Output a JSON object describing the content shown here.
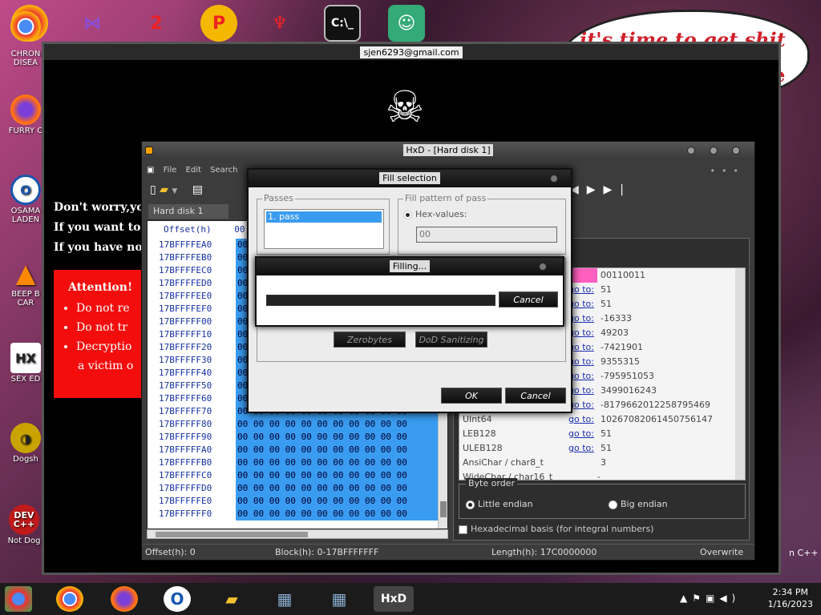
{
  "desktop": {
    "left_icons": [
      {
        "label": "CHRON\nDISEA",
        "icon": "chrome-icon"
      },
      {
        "label": "FURRY C",
        "icon": "firefox-icon"
      },
      {
        "label": "OSAMA\nLADEN",
        "icon": "obama-icon"
      },
      {
        "label": "BEEP B\nCAR",
        "icon": "vlc-icon"
      },
      {
        "label": "SEX ED",
        "icon": "hxd-icon"
      },
      {
        "label": "Dogsh",
        "icon": "dog-icon"
      },
      {
        "label": "Not Dog",
        "icon": "devcpp-icon"
      }
    ],
    "bubble_text": "it's time to get shit",
    "bubble_text2": "te",
    "right_label": "n C++"
  },
  "ransom": {
    "title": "sjen6293@gmail.com",
    "line1": "Don't worry,yo",
    "line2": "If you want to",
    "line3": "If you have not",
    "attention_title": "Attention!",
    "bullets": [
      "Do not re",
      "Do not tr",
      "Decryptio"
    ],
    "bullet_tail": "a victim o"
  },
  "hxd": {
    "title": "HxD - [Hard disk 1]",
    "menu": [
      "File",
      "Edit",
      "Search"
    ],
    "tab": "Hard disk 1",
    "hex_header": "Offset(h)",
    "hex_col": "00",
    "rows": [
      {
        "off": "17BFFFFEA0",
        "data": "00 00 00 00 00 00 00 00 00 00 00"
      },
      {
        "off": "17BFFFFEB0",
        "data": "00 00 00 00 00 00 00 00 00 00 00"
      },
      {
        "off": "17BFFFFEC0",
        "data": "00 00 00 00 00 00 00 00 00 00 00"
      },
      {
        "off": "17BFFFFED0",
        "data": "00 00 00 00 00 00 00 00 00 00 00"
      },
      {
        "off": "17BFFFFEE0",
        "data": "00 00 00 00 00 00 00 00 00 00 00"
      },
      {
        "off": "17BFFFFEF0",
        "data": "00 00 00 00 00 00 00 00 00 00 00"
      },
      {
        "off": "17BFFFFF00",
        "data": "00 00 00 00 00 00 00 00 00 00 00"
      },
      {
        "off": "17BFFFFF10",
        "data": "00 00 00 00 00 00 00 00 00 00 00"
      },
      {
        "off": "17BFFFFF20",
        "data": "00 00 00 00 00 00 00 00 00 00 00"
      },
      {
        "off": "17BFFFFF30",
        "data": "00 00 00 00 00 00 00 00 00 00 00"
      },
      {
        "off": "17BFFFFF40",
        "data": "00 00 00 00 00 00 00 00 00 00 00"
      },
      {
        "off": "17BFFFFF50",
        "data": "00 00 00 00 00 00 00 00 00 00 00"
      },
      {
        "off": "17BFFFFF60",
        "data": "00 00 00 00 00 00 00 00 00 00 00"
      },
      {
        "off": "17BFFFFF70",
        "data": "00 00 00 00 00 00 00 00 00 00 00"
      },
      {
        "off": "17BFFFFF80",
        "data": "00 00 00 00 00 00 00 00 00 00 00"
      },
      {
        "off": "17BFFFFF90",
        "data": "00 00 00 00 00 00 00 00 00 00 00"
      },
      {
        "off": "17BFFFFFA0",
        "data": "00 00 00 00 00 00 00 00 00 00 00"
      },
      {
        "off": "17BFFFFFB0",
        "data": "00 00 00 00 00 00 00 00 00 00 00"
      },
      {
        "off": "17BFFFFFC0",
        "data": "00 00 00 00 00 00 00 00 00 00 00"
      },
      {
        "off": "17BFFFFFD0",
        "data": "00 00 00 00 00 00 00 00 00 00 00"
      },
      {
        "off": "17BFFFFFE0",
        "data": "00 00 00 00 00 00 00 00 00 00 00"
      },
      {
        "off": "17BFFFFFF0",
        "data": "00 00 00 00 00 00 00 00 00 00 00"
      }
    ],
    "inspector": [
      {
        "name": "",
        "goto": "",
        "value": "00110011"
      },
      {
        "name": "",
        "goto": "go to:",
        "value": "51"
      },
      {
        "name": "",
        "goto": "go to:",
        "value": "51"
      },
      {
        "name": "",
        "goto": "go to:",
        "value": "-16333"
      },
      {
        "name": "",
        "goto": "go to:",
        "value": "49203"
      },
      {
        "name": "",
        "goto": "go to:",
        "value": "-7421901"
      },
      {
        "name": "",
        "goto": "go to:",
        "value": "9355315"
      },
      {
        "name": "",
        "goto": "go to:",
        "value": "-795951053"
      },
      {
        "name": "",
        "goto": "go to:",
        "value": "3499016243"
      },
      {
        "name": "",
        "goto": "go to:",
        "value": "-8179662012258795469"
      },
      {
        "name": "UInt64",
        "goto": "go to:",
        "value": "10267082061450756147"
      },
      {
        "name": "LEB128",
        "goto": "go to:",
        "value": "51"
      },
      {
        "name": "ULEB128",
        "goto": "go to:",
        "value": "51"
      },
      {
        "name": "AnsiChar / char8_t",
        "goto": "",
        "value": "3"
      },
      {
        "name": "WideChar / char16_t",
        "goto": "",
        "value": "̵"
      }
    ],
    "byte_order_label": "Byte order",
    "little_endian": "Little endian",
    "big_endian": "Big endian",
    "hex_basis": "Hexadecimal basis (for integral numbers)",
    "status_offset": "Offset(h): 0",
    "status_block": "Block(h): 0-17BFFFFFFF",
    "status_length": "Length(h): 17C0000000",
    "status_mode": "Overwrite"
  },
  "fill_dialog": {
    "title": "Fill selection",
    "passes_label": "Passes",
    "pass_item": "1. pass",
    "pattern_label": "Fill pattern of pass",
    "hex_values_label": "Hex-values:",
    "hex_value": "00",
    "zerobytes": "Zerobytes",
    "dod": "DoD Sanitizing",
    "ok": "OK",
    "cancel": "Cancel"
  },
  "filling_dialog": {
    "title": "Filling...",
    "cancel": "Cancel",
    "progress": 1.0
  },
  "taskbar": {
    "time": "2:34 PM",
    "date": "1/16/2023"
  }
}
